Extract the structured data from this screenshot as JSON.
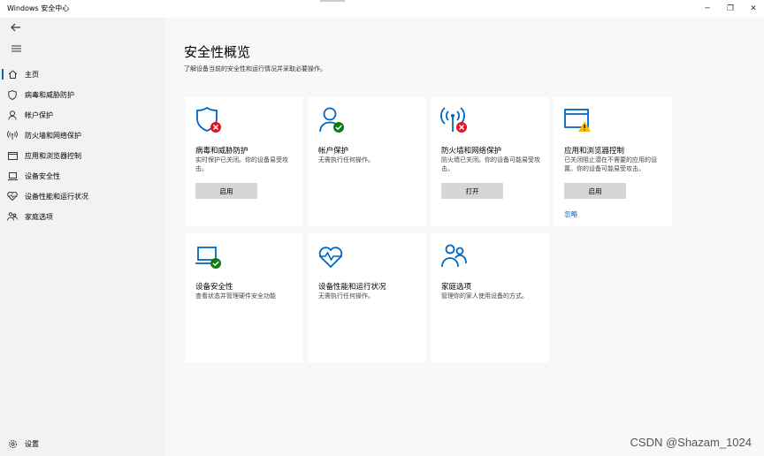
{
  "window": {
    "title": "Windows 安全中心",
    "controls": {
      "minimize": "─",
      "maximize": "❐",
      "close": "✕"
    }
  },
  "sidebar": {
    "items": [
      {
        "label": "主页",
        "icon": "home-icon"
      },
      {
        "label": "病毒和威胁防护",
        "icon": "shield-icon"
      },
      {
        "label": "帐户保护",
        "icon": "person-icon"
      },
      {
        "label": "防火墙和网络保护",
        "icon": "antenna-icon"
      },
      {
        "label": "应用和浏览器控制",
        "icon": "app-window-icon"
      },
      {
        "label": "设备安全性",
        "icon": "laptop-icon"
      },
      {
        "label": "设备性能和运行状况",
        "icon": "heart-icon"
      },
      {
        "label": "家庭选项",
        "icon": "family-icon"
      }
    ],
    "settings_label": "设置"
  },
  "main": {
    "title": "安全性概览",
    "subtitle": "了解设备当前的安全性和运行情况并采取必要操作。",
    "cards": [
      {
        "title": "病毒和威胁防护",
        "desc": "实时保护已关闭。你的设备易受攻击。",
        "button": "启用",
        "status": "error"
      },
      {
        "title": "帐户保护",
        "desc": "无需执行任何操作。",
        "status": "ok"
      },
      {
        "title": "防火墙和网络保护",
        "desc": "防火墙已关闭。你的设备可能易受攻击。",
        "button": "打开",
        "status": "error"
      },
      {
        "title": "应用和浏览器控制",
        "desc": "已关闭阻止潜在不需要的应用的设置。你的设备可能易受攻击。",
        "button": "启用",
        "link": "忽略",
        "status": "warning"
      },
      {
        "title": "设备安全性",
        "desc": "查看状态并管理硬件安全功能",
        "status": "ok"
      },
      {
        "title": "设备性能和运行状况",
        "desc": "无需执行任何操作。"
      },
      {
        "title": "家庭选项",
        "desc": "管理你的家人使用设备的方式。"
      }
    ]
  },
  "watermark": "CSDN @Shazam_1024",
  "colors": {
    "accent": "#0067c0",
    "error": "#e81123",
    "ok": "#107c10",
    "warning": "#ffb900"
  }
}
